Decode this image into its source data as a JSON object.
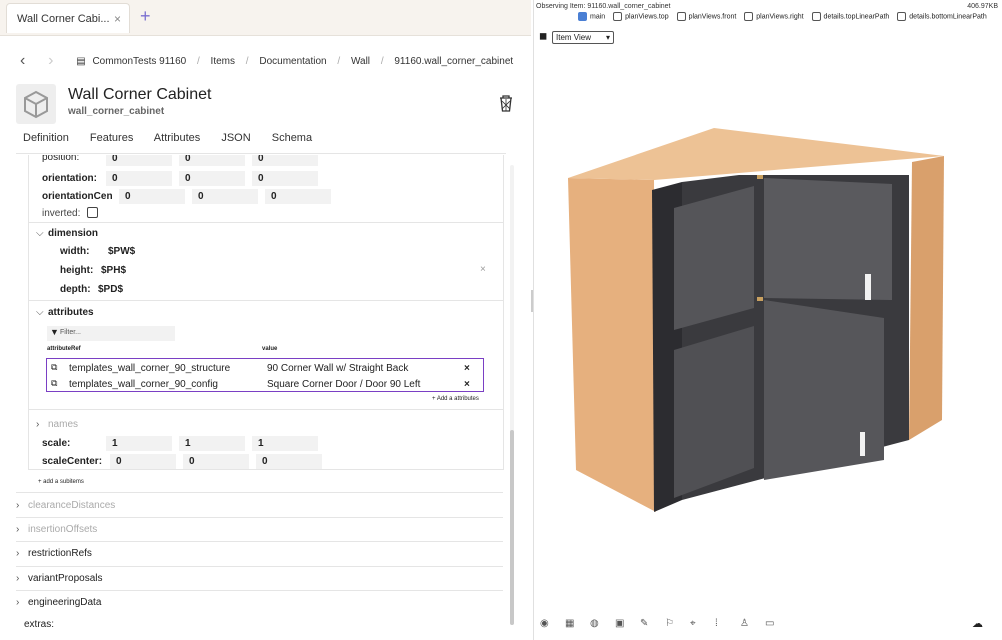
{
  "tab": {
    "title": "Wall Corner Cabi...",
    "close": "×",
    "new": "+"
  },
  "breadcrumb": [
    "CommonTests 91160",
    "Items",
    "Documentation",
    "Wall",
    "91160.wall_corner_cabinet"
  ],
  "header": {
    "title": "Wall Corner Cabinet",
    "subtitle": "wall_corner_cabinet"
  },
  "subtabs": [
    "Definition",
    "Features",
    "Attributes",
    "JSON",
    "Schema"
  ],
  "fields": {
    "position": {
      "label": "position:",
      "values": [
        "0",
        "0",
        "0"
      ]
    },
    "orientation": {
      "label": "orientation:",
      "values": [
        "0",
        "0",
        "0"
      ]
    },
    "orientationCen": {
      "label": "orientationCen",
      "values": [
        "0",
        "0",
        "0"
      ]
    },
    "inverted": {
      "label": "inverted:"
    }
  },
  "dimension": {
    "title": "dimension",
    "width_label": "width:",
    "width": "$PW$",
    "height_label": "height:",
    "height": "$PH$",
    "depth_label": "depth:",
    "depth": "$PD$"
  },
  "attributes": {
    "title": "attributes",
    "filter_placeholder": "Filter...",
    "col_ref": "attributeRef",
    "col_value": "value",
    "rows": [
      {
        "ref": "templates_wall_corner_90_structure",
        "value": "90 Corner Wall w/ Straight Back"
      },
      {
        "ref": "templates_wall_corner_90_config",
        "value": "Square Corner Door / Door 90 Left"
      }
    ],
    "add": "+ Add a attributes"
  },
  "names": "names",
  "scale": {
    "label": "scale:",
    "values": [
      "1",
      "1",
      "1"
    ]
  },
  "scaleCenter": {
    "label": "scaleCenter:",
    "values": [
      "0",
      "0",
      "0"
    ]
  },
  "add_subitems": "+ add a subitems",
  "sections": [
    {
      "label": "clearanceDistances",
      "muted": true
    },
    {
      "label": "insertionOffsets",
      "muted": true
    },
    {
      "label": "restrictionRefs",
      "muted": false
    },
    {
      "label": "variantProposals",
      "muted": false
    },
    {
      "label": "engineeringData",
      "muted": false
    }
  ],
  "extras": "extras:",
  "viewer": {
    "observing": "Observing Item: 91160.wall_corner_cabinet",
    "size": "406.97KB",
    "checkboxes": [
      {
        "label": "main",
        "checked": true
      },
      {
        "label": "planViews.top",
        "checked": false
      },
      {
        "label": "planViews.front",
        "checked": false
      },
      {
        "label": "planViews.right",
        "checked": false
      },
      {
        "label": "details.topLinearPath",
        "checked": false
      },
      {
        "label": "details.bottomLinearPath",
        "checked": false
      }
    ],
    "view_select": "Item View",
    "toolbar_icons": [
      "palette-icon",
      "grid-icon",
      "compass-icon",
      "cube-icon",
      "brush-icon",
      "flag-icon",
      "crosshair-icon",
      "dots-icon",
      "person-icon",
      "picture-icon"
    ],
    "colors": {
      "wood": "#e7b585",
      "door": "#4a4a4e",
      "accent": "#7a3fc4"
    }
  }
}
